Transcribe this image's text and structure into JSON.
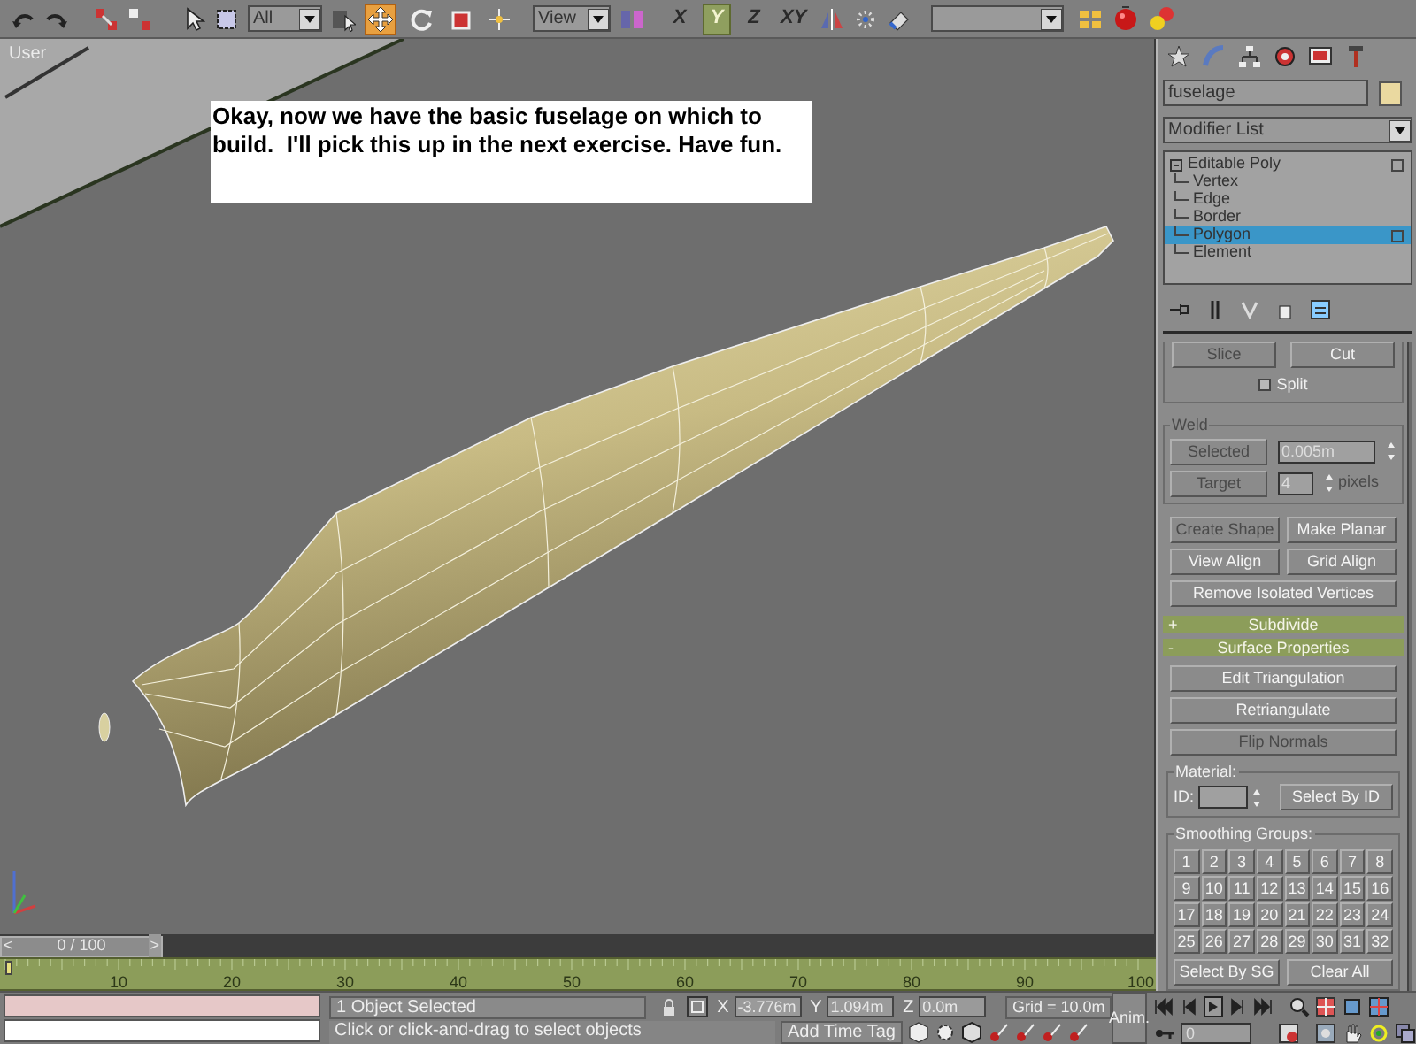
{
  "toolbar": {
    "selection_filter": "All",
    "reference_coordinate": "View",
    "transform_tools": [
      {
        "selected": true
      },
      {
        "selected": false
      },
      {
        "selected": false
      }
    ],
    "axis_constraints": [
      {
        "label": "X",
        "selected": false
      },
      {
        "label": "Y",
        "selected": true
      },
      {
        "label": "Z",
        "selected": false
      },
      {
        "label": "XY",
        "selected": false
      }
    ]
  },
  "viewport": {
    "label": "User",
    "note": "Okay, now we have the basic fuselage on which to build.  I'll pick this up in the next exercise. Have fun."
  },
  "command_panel": {
    "object_name": "fuselage",
    "modifier_list": "Modifier List",
    "stack": [
      {
        "label": "Editable Poly",
        "expanded": true,
        "children": [
          {
            "label": "Vertex",
            "selected": false
          },
          {
            "label": "Edge",
            "selected": false
          },
          {
            "label": "Border",
            "selected": false
          },
          {
            "label": "Polygon",
            "selected": true
          },
          {
            "label": "Element",
            "selected": false
          }
        ]
      }
    ],
    "edit_geometry": {
      "slice": {
        "label": "Slice",
        "disabled": true
      },
      "cut": {
        "label": "Cut",
        "disabled": false
      },
      "split": {
        "label": "Split",
        "checked": false
      },
      "weld": {
        "title": "Weld",
        "disabled": true,
        "selected": {
          "label": "Selected",
          "disabled": true
        },
        "selected_value": "0.005m",
        "target": {
          "label": "Target",
          "disabled": true
        },
        "target_value": "4",
        "target_unit": "pixels"
      },
      "button_rows": [
        [
          {
            "label": "Create Shape",
            "disabled": true
          },
          {
            "label": "Make Planar",
            "disabled": false
          }
        ],
        [
          {
            "label": "View Align",
            "disabled": false
          },
          {
            "label": "Grid Align",
            "disabled": false
          }
        ],
        [
          {
            "label": "Remove Isolated Vertices",
            "disabled": false
          }
        ]
      ]
    },
    "rollouts": [
      {
        "toggle": "+",
        "title": "Subdivide"
      },
      {
        "toggle": "-",
        "title": "Surface Properties"
      }
    ],
    "surface_properties": {
      "buttons": [
        {
          "label": "Edit Triangulation",
          "disabled": false
        },
        {
          "label": "Retriangulate",
          "disabled": false
        },
        {
          "label": "Flip Normals",
          "disabled": true
        }
      ],
      "material_title": "Material:",
      "id_label": "ID:",
      "select_by_id": "Select By ID",
      "smoothing_title": "Smoothing Groups:",
      "groups": [
        "1",
        "2",
        "3",
        "4",
        "5",
        "6",
        "7",
        "8",
        "9",
        "10",
        "11",
        "12",
        "13",
        "14",
        "15",
        "16",
        "17",
        "18",
        "19",
        "20",
        "21",
        "22",
        "23",
        "24",
        "25",
        "26",
        "27",
        "28",
        "29",
        "30",
        "31",
        "32"
      ],
      "select_by_sg": "Select By SG",
      "clear_all": "Clear All"
    }
  },
  "timeline": {
    "prev": "<",
    "position": "0 / 100",
    "next": ">",
    "ticks": [
      "10",
      "20",
      "30",
      "40",
      "50",
      "60",
      "70",
      "80",
      "90",
      "100"
    ]
  },
  "status_bar": {
    "selection": "1 Object Selected",
    "prompt": "Click or click-and-drag to select objects",
    "coordinates": [
      {
        "axis": "X",
        "value": "-3.776m"
      },
      {
        "axis": "Y",
        "value": "1.094m"
      },
      {
        "axis": "Z",
        "value": "0.0m"
      }
    ],
    "grid": "Grid = 10.0m",
    "add_time_tag": "Add Time Tag",
    "animate": "Anim.",
    "frame": "0"
  }
}
